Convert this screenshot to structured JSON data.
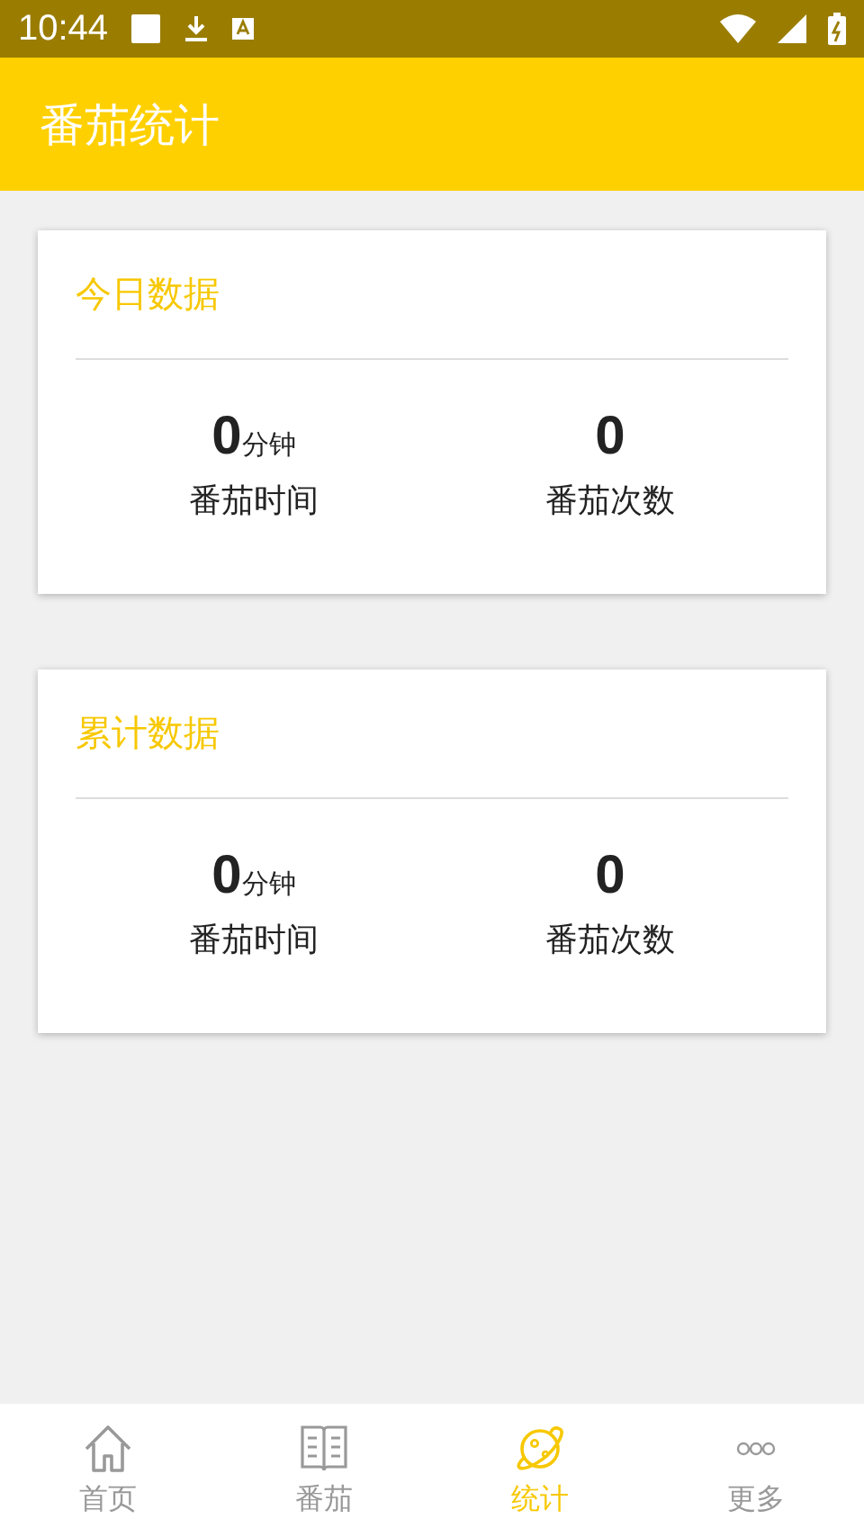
{
  "status_bar": {
    "time": "10:44"
  },
  "app_bar": {
    "title": "番茄统计"
  },
  "cards": [
    {
      "title": "今日数据",
      "stats": [
        {
          "value": "0",
          "unit": "分钟",
          "label": "番茄时间"
        },
        {
          "value": "0",
          "label": "番茄次数"
        }
      ]
    },
    {
      "title": "累计数据",
      "stats": [
        {
          "value": "0",
          "unit": "分钟",
          "label": "番茄时间"
        },
        {
          "value": "0",
          "label": "番茄次数"
        }
      ]
    }
  ],
  "bottom_nav": [
    {
      "kind": "home",
      "label": "首页",
      "selected": false
    },
    {
      "kind": "book",
      "label": "番茄",
      "selected": false
    },
    {
      "kind": "planet",
      "label": "统计",
      "selected": true
    },
    {
      "kind": "more",
      "label": "更多",
      "selected": false
    }
  ]
}
